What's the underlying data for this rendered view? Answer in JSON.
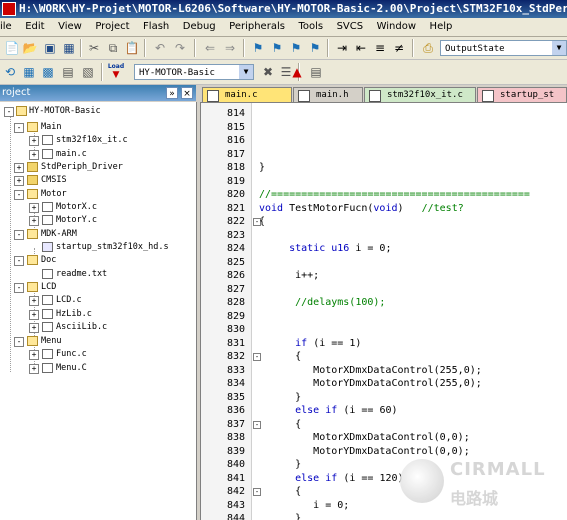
{
  "window": {
    "title": "H:\\WORK\\HY-Projet\\MOTOR-L6206\\Software\\HY-MOTOR-Basic-2.00\\Project\\STM32F10x_StdPer"
  },
  "menu": [
    "ile",
    "Edit",
    "View",
    "Project",
    "Flash",
    "Debug",
    "Peripherals",
    "Tools",
    "SVCS",
    "Window",
    "Help"
  ],
  "toolbar1": {
    "dropdown_value": "OutputState"
  },
  "toolbar2": {
    "load_label": "Load",
    "target_value": "HY-MOTOR-Basic"
  },
  "project_panel": {
    "title": "roject",
    "pin": "»",
    "close": "×"
  },
  "tree": [
    {
      "label": "HY-MOTOR-Basic",
      "type": "folder-root"
    },
    {
      "label": "Main",
      "type": "folder"
    },
    {
      "label": "stm32f10x_it.c",
      "type": "file"
    },
    {
      "label": "main.c",
      "type": "file"
    },
    {
      "label": "StdPeriph_Driver",
      "type": "folder"
    },
    {
      "label": "CMSIS",
      "type": "folder"
    },
    {
      "label": "Motor",
      "type": "folder"
    },
    {
      "label": "MotorX.c",
      "type": "file"
    },
    {
      "label": "MotorY.c",
      "type": "file"
    },
    {
      "label": "MDK-ARM",
      "type": "folder"
    },
    {
      "label": "startup_stm32f10x_hd.s",
      "type": "asm"
    },
    {
      "label": "Doc",
      "type": "folder"
    },
    {
      "label": "readme.txt",
      "type": "file"
    },
    {
      "label": "LCD",
      "type": "folder"
    },
    {
      "label": "LCD.c",
      "type": "file"
    },
    {
      "label": "HzLib.c",
      "type": "file"
    },
    {
      "label": "AsciiLib.c",
      "type": "file"
    },
    {
      "label": "Menu",
      "type": "folder"
    },
    {
      "label": "Func.c",
      "type": "file"
    },
    {
      "label": "Menu.C",
      "type": "file"
    }
  ],
  "tabs": [
    {
      "label": "main.c",
      "color": "#ffe477"
    },
    {
      "label": "main.h",
      "color": "#d4d0c8"
    },
    {
      "label": "stm32f10x_it.c",
      "color": "#cfe8c8"
    },
    {
      "label": "startup_st",
      "color": "#f4c4c8"
    }
  ],
  "code_lines": [
    {
      "num": "814",
      "fold": "",
      "text": ""
    },
    {
      "num": "815",
      "fold": "",
      "text": ""
    },
    {
      "num": "816",
      "fold": "",
      "text": ""
    },
    {
      "num": "817",
      "fold": "",
      "text": ""
    },
    {
      "num": "818",
      "fold": "",
      "text": "}"
    },
    {
      "num": "819",
      "fold": "",
      "text": ""
    },
    {
      "num": "820",
      "fold": "",
      "text": "//==========================================="
    },
    {
      "num": "821",
      "fold": "",
      "text": "void TestMotorFucn(void)   //test?"
    },
    {
      "num": "822",
      "fold": "-",
      "text": "{"
    },
    {
      "num": "823",
      "fold": "",
      "text": ""
    },
    {
      "num": "824",
      "fold": "",
      "text": "     static u16 i = 0;"
    },
    {
      "num": "825",
      "fold": "",
      "text": ""
    },
    {
      "num": "826",
      "fold": "",
      "text": "      i++;"
    },
    {
      "num": "827",
      "fold": "",
      "text": ""
    },
    {
      "num": "828",
      "fold": "",
      "text": "      //delayms(100);"
    },
    {
      "num": "829",
      "fold": "",
      "text": ""
    },
    {
      "num": "830",
      "fold": "",
      "text": ""
    },
    {
      "num": "831",
      "fold": "",
      "text": "      if (i == 1)"
    },
    {
      "num": "832",
      "fold": "-",
      "text": "      {"
    },
    {
      "num": "833",
      "fold": "",
      "text": "         MotorXDmxDataControl(255,0);"
    },
    {
      "num": "834",
      "fold": "",
      "text": "         MotorYDmxDataControl(255,0);"
    },
    {
      "num": "835",
      "fold": "",
      "text": "      }"
    },
    {
      "num": "836",
      "fold": "",
      "text": "      else if (i == 60)"
    },
    {
      "num": "837",
      "fold": "-",
      "text": "      {"
    },
    {
      "num": "838",
      "fold": "",
      "text": "         MotorXDmxDataControl(0,0);"
    },
    {
      "num": "839",
      "fold": "",
      "text": "         MotorYDmxDataControl(0,0);"
    },
    {
      "num": "840",
      "fold": "",
      "text": "      }"
    },
    {
      "num": "841",
      "fold": "",
      "text": "      else if (i == 120)"
    },
    {
      "num": "842",
      "fold": "-",
      "text": "      {"
    },
    {
      "num": "843",
      "fold": "",
      "text": "         i = 0;"
    },
    {
      "num": "844",
      "fold": "",
      "text": "      }"
    }
  ],
  "watermark": {
    "brand": "CIRMALL",
    "sub": "电路城"
  }
}
